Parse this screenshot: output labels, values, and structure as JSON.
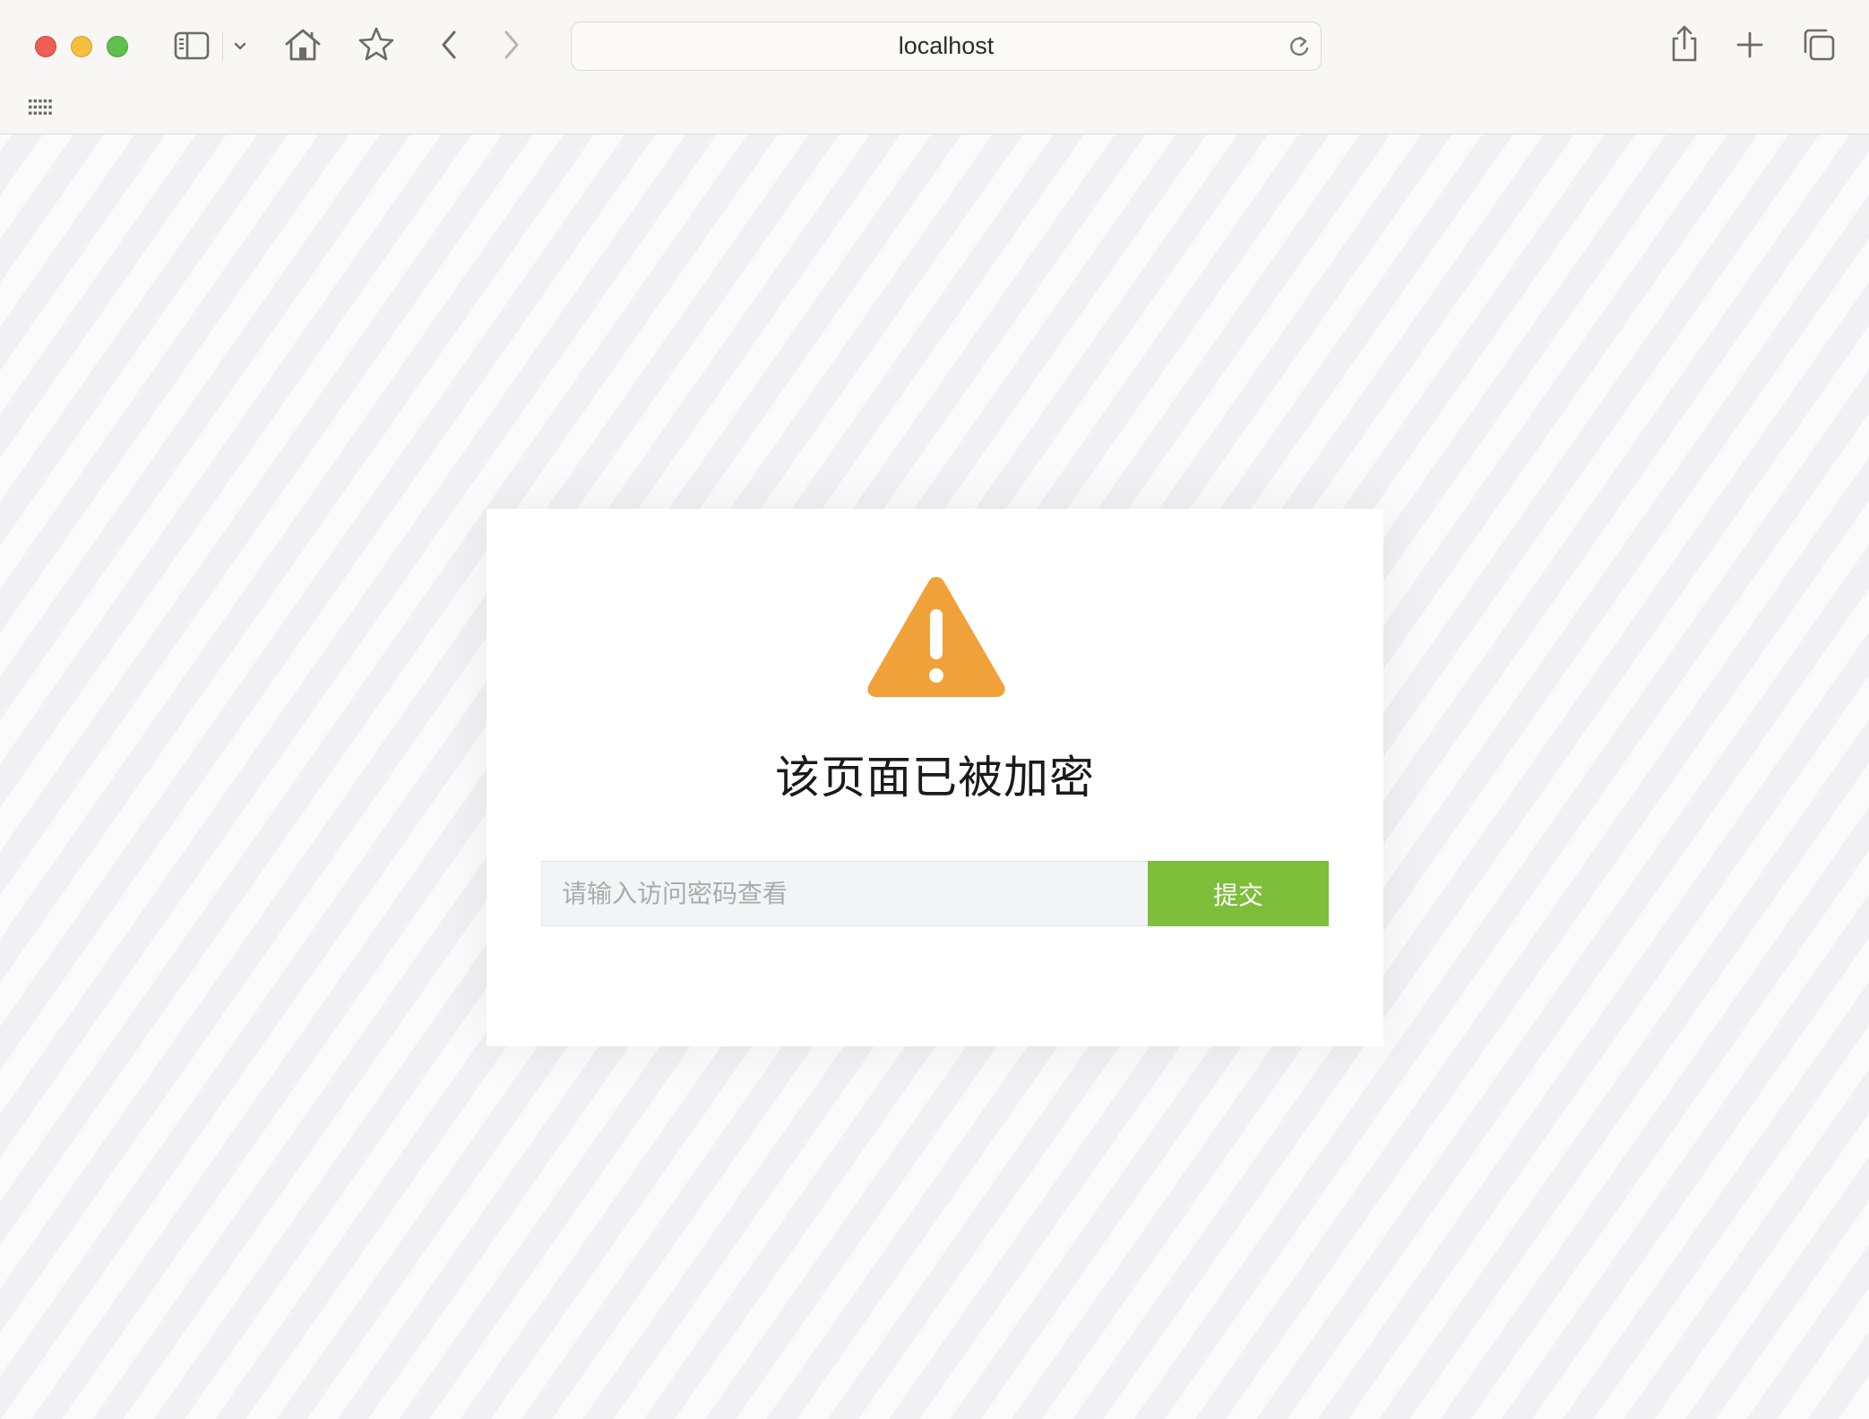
{
  "browser": {
    "address_text": "localhost",
    "icons": {
      "sidebar": "sidebar-icon",
      "sidebar_menu": "chevron-down-icon",
      "home": "home-icon",
      "bookmark": "star-icon",
      "back": "chevron-left-icon",
      "forward": "chevron-right-icon",
      "reload": "reload-icon",
      "share": "share-icon",
      "new_tab": "plus-icon",
      "tabs_overview": "tabs-overview-icon",
      "favorites_grid": "grid-icon"
    }
  },
  "page": {
    "title": "该页面已被加密",
    "password_placeholder": "请输入访问密码查看",
    "password_value": "",
    "submit_label": "提交",
    "icon": "warning-icon",
    "colors": {
      "warning": "#f1a13a",
      "submit": "#7dbe3a"
    }
  }
}
